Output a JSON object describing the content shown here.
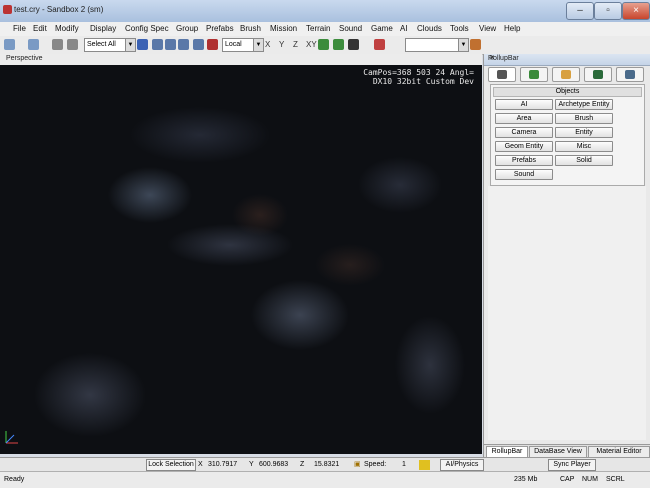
{
  "window": {
    "title": "test.cry - Sandbox 2 (sm)",
    "controls": [
      "minimize",
      "maximize",
      "close"
    ]
  },
  "menu": [
    "File",
    "Edit",
    "Modify",
    "Display",
    "Config Spec",
    "Group",
    "Prefabs",
    "Brush",
    "Mission",
    "Terrain",
    "Sound",
    "Game",
    "AI",
    "Clouds",
    "Tools",
    "View",
    "Help"
  ],
  "toolbar": {
    "select_filter": "Select All",
    "ref_coord": "Local",
    "axes": [
      "X",
      "Y",
      "Z",
      "XY"
    ],
    "icons": [
      "undo-icon",
      "redo-icon",
      "link-icon",
      "unlink-icon",
      "select-icon",
      "move-icon",
      "rotate-icon",
      "scale-icon",
      "select-terrain-icon",
      "snap-grid-icon",
      "snap-angle-icon",
      "terrain-snap-icon",
      "terrain-texture-icon",
      "render-layer-icon"
    ]
  },
  "viewport": {
    "label": "Perspective",
    "info_line1": "CamPos=368 503 24 Angl=",
    "info_line2": "DX10 32bit Custom Dev"
  },
  "rollup": {
    "title": "RollupBar",
    "tabs": [
      "objects-tab",
      "terrain-tab",
      "modelling-tab",
      "display-tab",
      "layers-tab"
    ],
    "objects_header": "Objects",
    "buttons": [
      "AI",
      "Archetype Entity",
      "Area",
      "Brush",
      "Camera",
      "Entity",
      "Geom Entity",
      "Misc",
      "Prefabs",
      "Solid",
      "Sound"
    ],
    "bottom_tabs": [
      "RollupBar",
      "DataBase View",
      "Material Editor"
    ]
  },
  "statusbar": {
    "lock_selection": "Lock Selection",
    "x_label": "X",
    "x_value": "310.7917",
    "y_label": "Y",
    "y_value": "600.9683",
    "z_label": "Z",
    "z_value": "15.8321",
    "speed_label": "Speed:",
    "speed_value": "1",
    "ai_physics": "AI/Physics",
    "sync_player": "Sync Player"
  },
  "status2": {
    "ready": "Ready",
    "memory": "235 Mb",
    "cap": "CAP",
    "num": "NUM",
    "scrl": "SCRL"
  }
}
